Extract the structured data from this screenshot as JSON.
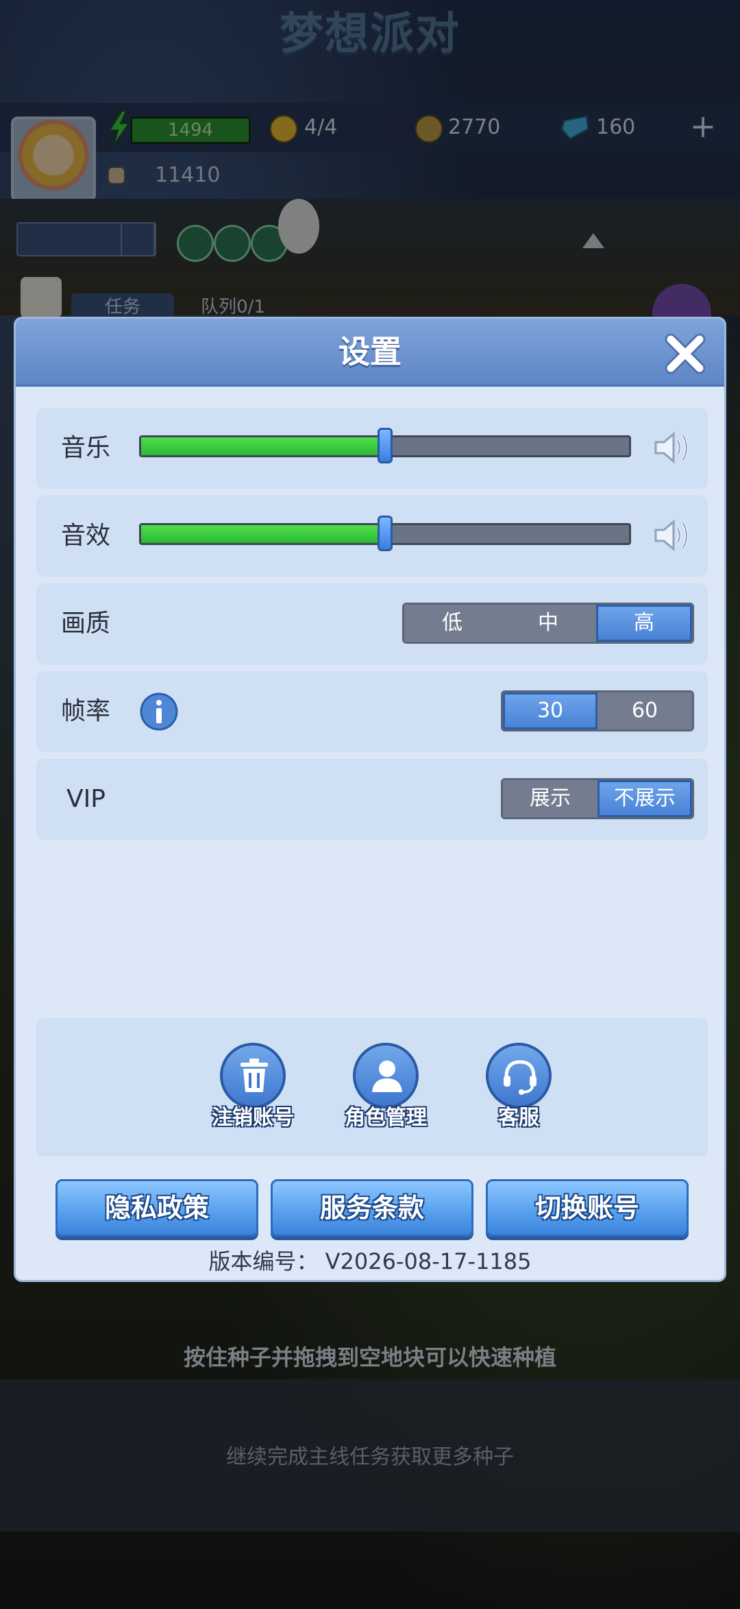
{
  "game": {
    "logo_text": "梦想派对",
    "energy": "1494",
    "stamina": "4/4",
    "coins": "2770",
    "gems": "160",
    "power": "11410",
    "task_tab": "任务",
    "queue_tab": "队列0/1"
  },
  "settings": {
    "title": "设置",
    "music": {
      "label": "音乐",
      "level": 0.5
    },
    "sfx": {
      "label": "音效",
      "level": 0.5
    },
    "quality": {
      "label": "画质",
      "options": [
        "低",
        "中",
        "高"
      ],
      "selected": "高"
    },
    "framerate": {
      "label": "帧率",
      "options": [
        "30",
        "60"
      ],
      "selected": "30"
    },
    "vip": {
      "label": "VIP",
      "options": [
        "展示",
        "不展示"
      ],
      "selected": "不展示"
    },
    "actions": {
      "delete_account": "注销账号",
      "role_manage": "角色管理",
      "support": "客服"
    },
    "buttons": {
      "privacy": "隐私政策",
      "terms": "服务条款",
      "switch_account": "切换账号"
    },
    "version": "版本编号：  V2026-08-17-1185"
  },
  "hints": {
    "tip1": "按住种子并拖拽到空地块可以快速种植",
    "tip2": "继续完成主线任务获取更多种子"
  },
  "colors": {
    "header": "#6a90cf",
    "slider_fill": "#35c23b",
    "active_segment": "#4a82d6",
    "panel": "#dce8f7"
  }
}
